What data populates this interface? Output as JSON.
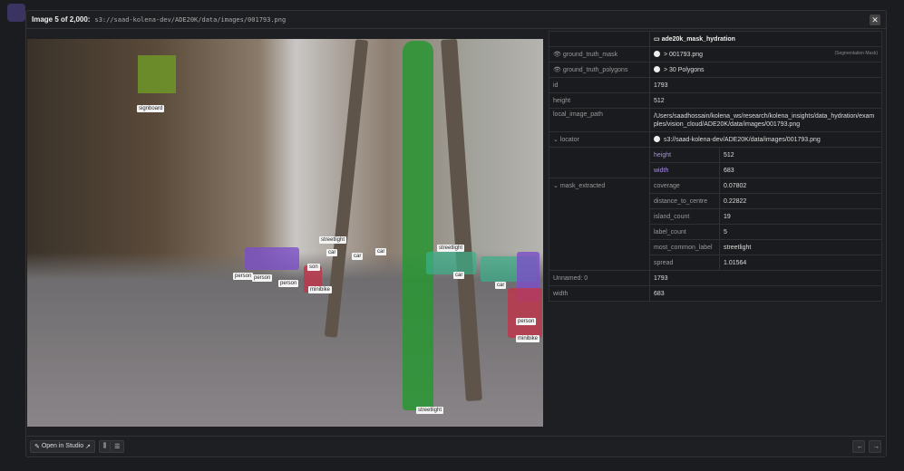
{
  "header": {
    "title": "Image 5 of 2,000:",
    "path": "s3://saad-kolena-dev/ADE20K/data/images/001793.png"
  },
  "image": {
    "labels": [
      "signboard",
      "streetlight",
      "streetlight",
      "streetlight",
      "car",
      "car",
      "car",
      "car",
      "car",
      "person",
      "person",
      "person",
      "person",
      "minibike",
      "minibike",
      "son"
    ],
    "colors": {
      "streetlight": "#2e9a3a",
      "car": "#3bb08a",
      "person": "#7a4fc8",
      "minibike": "#c0344a",
      "signboard": "#8fb030"
    }
  },
  "panel": {
    "title": "ade20k_mask_hydration",
    "rows": {
      "gtm_key": "ground_truth_mask",
      "gtm_val": "> 001793.png",
      "gtm_note": "(Segmentation Mask)",
      "gtp_key": "ground_truth_polygons",
      "gtp_val": "> 30 Polygons",
      "id_key": "id",
      "id_val": "1793",
      "height_key": "height",
      "height_val": "512",
      "lip_key": "local_image_path",
      "lip_val": "/Users/saadhossain/kolena_ws/research/kolena_insights/data_hydration/examples/vision_cloud/ADE20K/data/images/001793.png",
      "loc_key": "locator",
      "loc_val": "s3://saad-kolena-dev/ADE20K/data/images/001793.png",
      "loc_h_key": "height",
      "loc_h_val": "512",
      "loc_w_key": "width",
      "loc_w_val": "683",
      "me_key": "mask_extracted",
      "me": [
        [
          "coverage",
          "0.07802"
        ],
        [
          "distance_to_centre",
          "0.22822"
        ],
        [
          "island_count",
          "19"
        ],
        [
          "label_count",
          "5"
        ],
        [
          "most_common_label",
          "streetlight"
        ],
        [
          "spread",
          "1.01564"
        ]
      ],
      "un_key": "Unnamed: 0",
      "un_val": "1793",
      "w_key": "width",
      "w_val": "683"
    }
  },
  "footer": {
    "open_studio": "Open in Studio"
  }
}
